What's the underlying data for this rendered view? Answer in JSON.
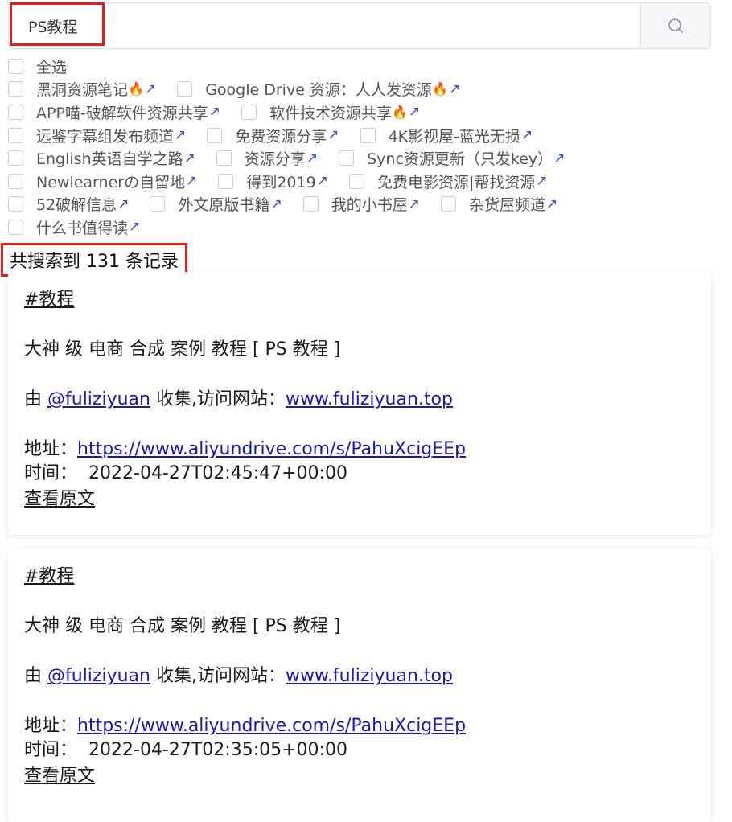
{
  "search": {
    "value": "PS教程",
    "placeholder": ""
  },
  "select_all": "全选",
  "filter_rows": [
    [
      {
        "label": "黑洞资源笔记",
        "fire": true
      },
      {
        "label": "Google Drive 资源：人人发资源",
        "fire": true
      }
    ],
    [
      {
        "label": "APP喵-破解软件资源共享",
        "fire": false
      },
      {
        "label": "软件技术资源共享",
        "fire": true
      }
    ],
    [
      {
        "label": "远鉴字幕组发布频道",
        "fire": false
      },
      {
        "label": "免费资源分享",
        "fire": false
      },
      {
        "label": "4K影视屋-蓝光无损",
        "fire": false
      }
    ],
    [
      {
        "label": "English英语自学之路",
        "fire": false
      },
      {
        "label": "资源分享",
        "fire": false
      },
      {
        "label": "Sync资源更新（只发key）",
        "fire": false
      }
    ],
    [
      {
        "label": "Newlearnerの自留地",
        "fire": false
      },
      {
        "label": "得到2019",
        "fire": false
      },
      {
        "label": "免费电影资源|帮找资源",
        "fire": false
      }
    ],
    [
      {
        "label": "52破解信息",
        "fire": false
      },
      {
        "label": "外文原版书籍",
        "fire": false
      },
      {
        "label": "我的小书屋",
        "fire": false
      },
      {
        "label": "杂货屋频道",
        "fire": false
      }
    ],
    [
      {
        "label": "什么书值得读",
        "fire": false
      }
    ]
  ],
  "result_count": "共搜索到 131 条记录",
  "results": [
    {
      "tag": "#教程",
      "title": "大神 级 电商 合成 案例 教程 [ PS 教程 ]",
      "by_prefix": "由 ",
      "by_user": "@fuliziyuan",
      "by_mid": " 收集,访问网站：",
      "site": "www.fuliziyuan.top",
      "addr_label": "地址：",
      "addr_url": "https://www.aliyundrive.com/s/PahuXcigEEp",
      "time_label": "时间：",
      "time_value": "2022-04-27T02:45:47+00:00",
      "view": "查看原文"
    },
    {
      "tag": "#教程",
      "title": "大神 级 电商 合成 案例 教程 [ PS 教程 ]",
      "by_prefix": "由 ",
      "by_user": "@fuliziyuan",
      "by_mid": " 收集,访问网站：",
      "site": "www.fuliziyuan.top",
      "addr_label": "地址：",
      "addr_url": "https://www.aliyundrive.com/s/PahuXcigEEp",
      "time_label": "时间：",
      "time_value": "2022-04-27T02:35:05+00:00",
      "view": "查看原文"
    }
  ],
  "colors": {
    "highlight": "#e02020",
    "link": "#1a1aa6"
  }
}
